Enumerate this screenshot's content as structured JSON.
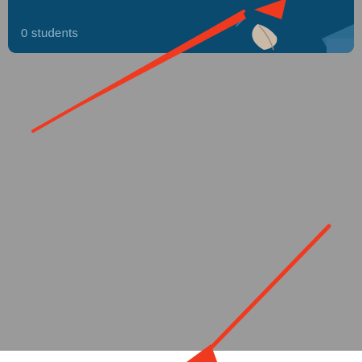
{
  "class_card": {
    "count_text": "0 students"
  },
  "colors": {
    "overlay_gray": "#9a9a9a",
    "card_blue": "#0a4a6f",
    "card_text": "#8fb3c8",
    "annotation_red": "#f03a1f",
    "sheet_white": "#ffffff"
  },
  "annotations": {
    "arrows": [
      "annotation-arrow-upper",
      "annotation-arrow-lower"
    ]
  }
}
